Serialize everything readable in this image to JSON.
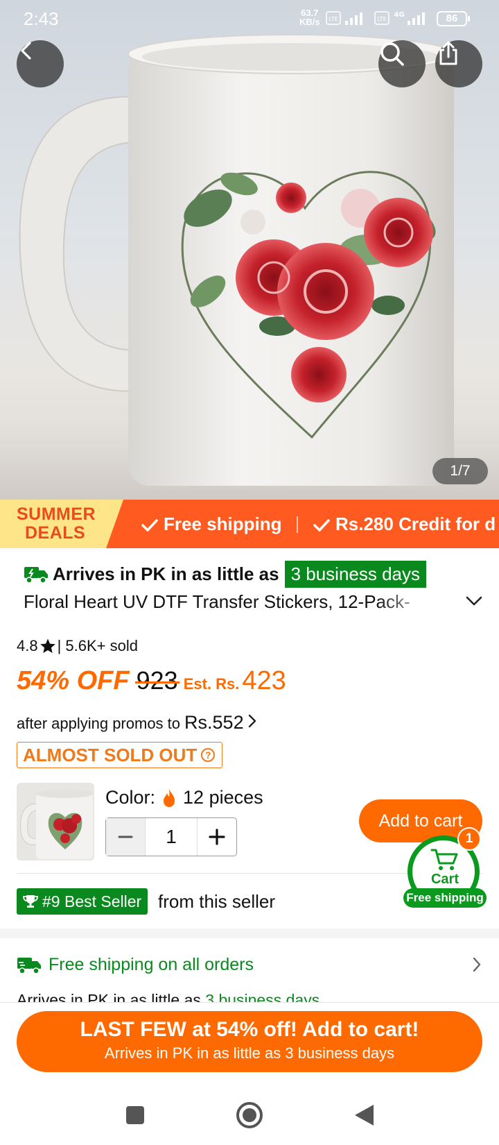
{
  "status_bar": {
    "time": "2:43",
    "net_speed_value": "63.7",
    "net_speed_unit": "KB/s",
    "sim1_label": "Vo LTE",
    "sim2_label": "Vo LTE",
    "network_type": "4G",
    "battery": "86"
  },
  "gallery": {
    "counter": "1/7",
    "icons": {
      "back": "chevron-left-icon",
      "search": "search-icon",
      "share": "share-icon"
    }
  },
  "promo_strip": {
    "badge_line1": "SUMMER",
    "badge_line2": "DEALS",
    "items": [
      "Free shipping",
      "Rs.280 Credit for d"
    ]
  },
  "delivery": {
    "text": "Arrives in PK in as little as",
    "days": "3 business days"
  },
  "product": {
    "title": "Floral Heart UV DTF Transfer Stickers, 12-Pack-",
    "rating": "4.8",
    "sold": "| 5.6K+ sold",
    "discount": "54% OFF",
    "original_price": "923",
    "est_label": "Est. Rs.",
    "est_price": "423",
    "promo_text": "after applying promos to",
    "promo_price": "Rs.552",
    "stock_badge": "ALMOST SOLD OUT",
    "color_label": "Color:",
    "color_value": "12 pieces",
    "quantity": "1",
    "add_to_cart": "Add to cart",
    "best_seller": "#9 Best Seller",
    "best_seller_suffix": "from this seller"
  },
  "floating_cart": {
    "label": "Cart",
    "count": "1",
    "badge": "Free shipping"
  },
  "shipping": {
    "title": "Free shipping on all orders",
    "sub_text": "Arrives in PK in as little as",
    "sub_days": "3 business days"
  },
  "cta": {
    "line1": "LAST FEW at 54% off! Add to cart!",
    "line2": "Arrives in PK in as little as 3 business days"
  },
  "colors": {
    "accent_orange": "#ff6a00",
    "promo_orange": "#ff5a1f",
    "green": "#0a8a1e",
    "badge_yellow": "#ffe58a"
  }
}
